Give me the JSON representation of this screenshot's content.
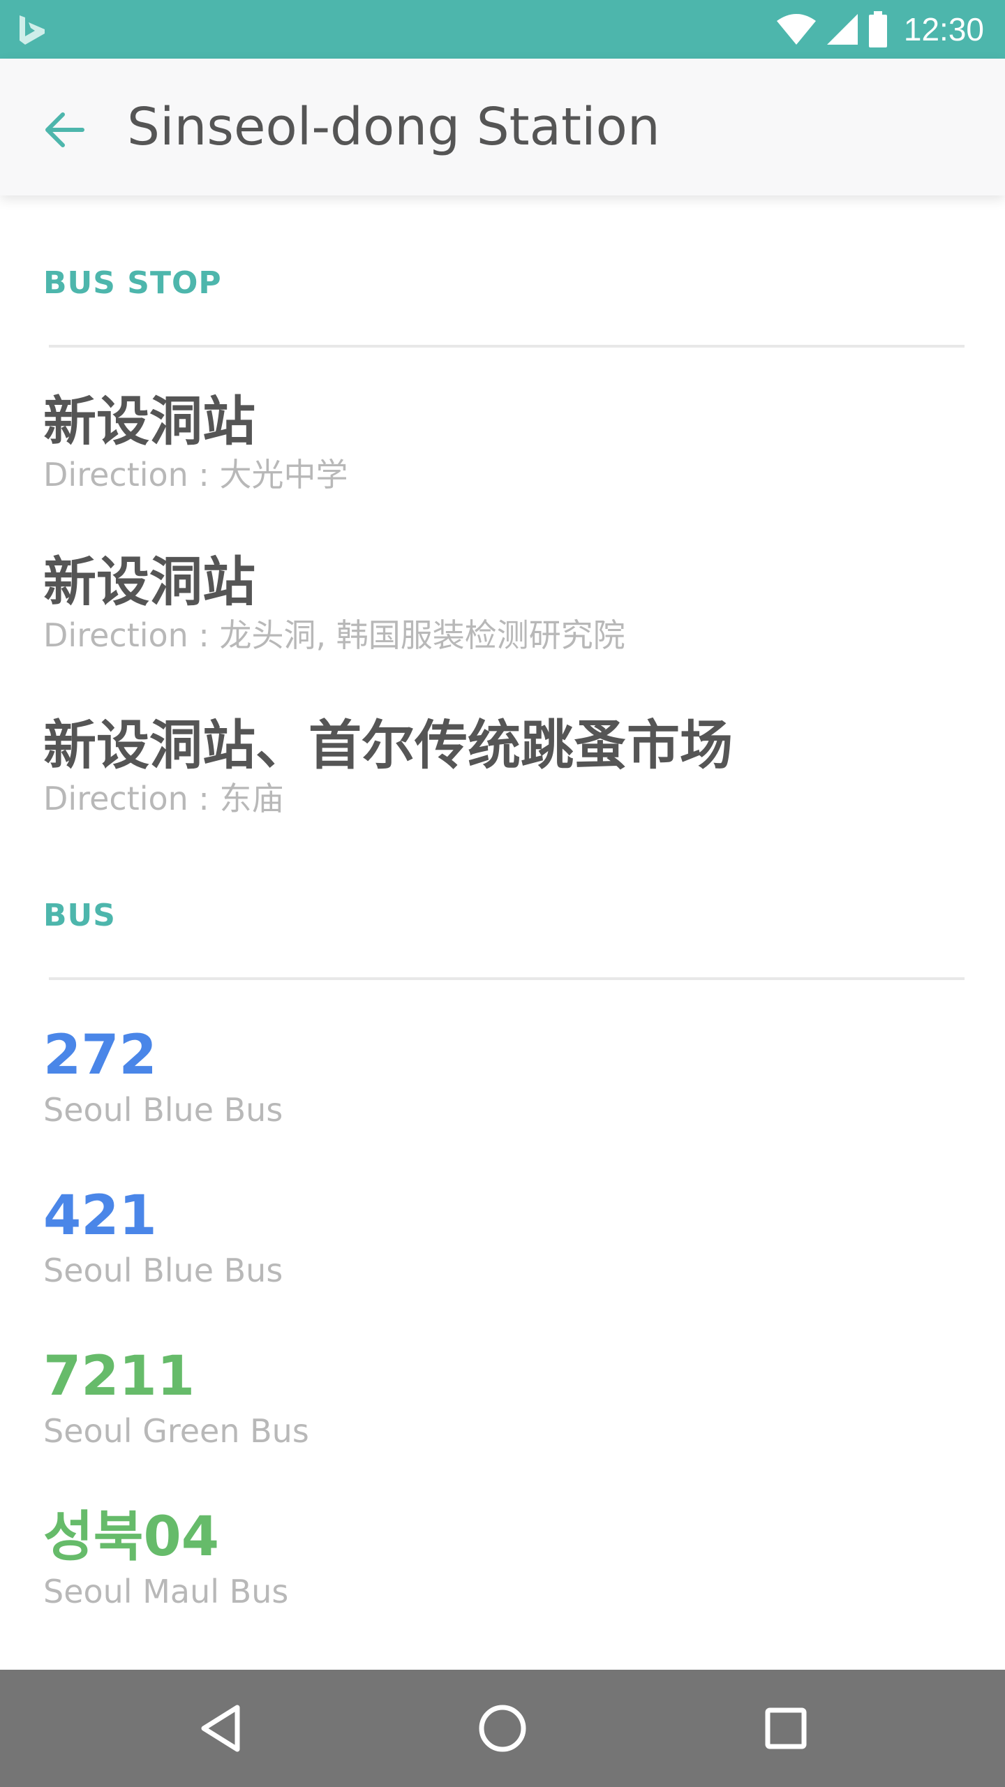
{
  "status_bar": {
    "time": "12:30",
    "icons": [
      "bing-logo-icon",
      "wifi-icon",
      "signal-icon",
      "battery-icon"
    ],
    "bg_color": "#4db6ac"
  },
  "toolbar": {
    "back_icon": "arrow-back-icon",
    "title": "Sinseol-dong Station"
  },
  "sections": {
    "bus_stop_header": "BUS STOP",
    "bus_header": "BUS"
  },
  "bus_stops": [
    {
      "name": "新设洞站",
      "direction": "Direction : 大光中学"
    },
    {
      "name": "新设洞站",
      "direction": "Direction : 龙头洞, 韩国服装检测研究院"
    },
    {
      "name": "新设洞站、首尔传统跳蚤市场",
      "direction": "Direction : 东庙"
    }
  ],
  "buses": [
    {
      "number": "272",
      "type": "Seoul Blue Bus",
      "color": "#4a86e8"
    },
    {
      "number": "421",
      "type": "Seoul Blue Bus",
      "color": "#4a86e8"
    },
    {
      "number": "7211",
      "type": "Seoul Green Bus",
      "color": "#66bb6a"
    },
    {
      "number": "성북04",
      "type": "Seoul Maul Bus",
      "color": "#66bb6a"
    }
  ],
  "nav_bar": {
    "icons": [
      "back-triangle-icon",
      "home-circle-icon",
      "recents-square-icon"
    ]
  },
  "colors": {
    "accent": "#4db6ac",
    "blue_bus": "#4a86e8",
    "green_bus": "#66bb6a"
  }
}
